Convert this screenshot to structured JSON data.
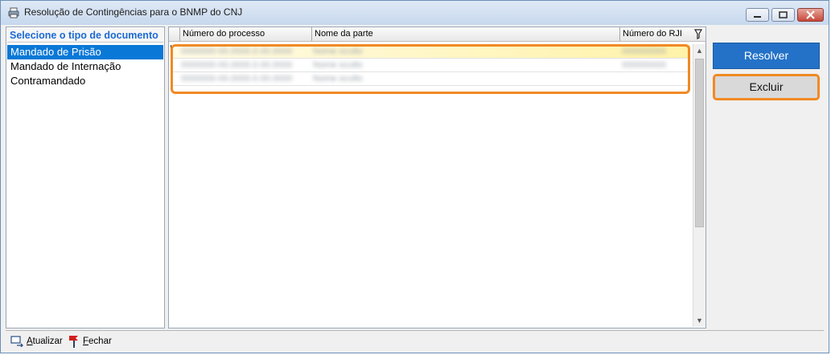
{
  "window": {
    "title": "Resolução de Contingências para o BNMP do CNJ",
    "icons": {
      "app": "printer-icon",
      "minimize": "minimize-icon",
      "maximize": "maximize-icon",
      "close": "close-icon"
    }
  },
  "document_types": {
    "header": "Selecione o tipo de documento",
    "items": [
      {
        "label": "Mandado de Prisão",
        "selected": true
      },
      {
        "label": "Mandado de Internação",
        "selected": false
      },
      {
        "label": "Contramandado",
        "selected": false
      }
    ]
  },
  "grid": {
    "columns": [
      "Número do processo",
      "Nome da parte",
      "Número do RJI"
    ],
    "filter_icon": "filter-icon",
    "rows": [
      {
        "processo": "0000000-00.0000.0.00.0000",
        "parte": "Nome oculto",
        "rji": "000000000"
      },
      {
        "processo": "0000000-00.0000.0.00.0000",
        "parte": "Nome oculto",
        "rji": "000000000"
      },
      {
        "processo": "0000000-00.0000.0.00.0000",
        "parte": "Nome oculto",
        "rji": ""
      }
    ]
  },
  "actions": {
    "resolver_label": "Resolver",
    "excluir_label": "Excluir"
  },
  "footer": {
    "atualizar": {
      "mnemonic": "A",
      "rest": "tualizar",
      "icon": "refresh-icon"
    },
    "fechar": {
      "mnemonic": "F",
      "rest": "echar",
      "icon": "exit-icon"
    }
  },
  "colors": {
    "accent": "#2472c8",
    "highlight": "#f08a24",
    "selection": "#0a78d7",
    "header_text": "#1c6ad4"
  }
}
